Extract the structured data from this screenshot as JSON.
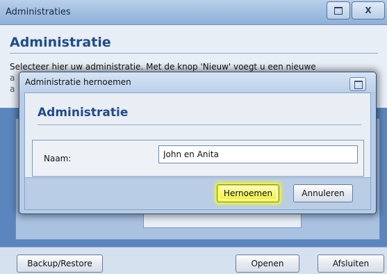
{
  "background_window": {
    "title": "Administraties",
    "heading": "Administratie",
    "description_line1": "Selecteer hier uw administratie. Met de knop 'Nieuw' voegt u een nieuwe",
    "description_line2": "a",
    "description_line3": "a",
    "buttons": {
      "backup_restore": "Backup/Restore",
      "open": "Openen",
      "close": "Afsluiten"
    },
    "window_controls": {
      "restore_icon": "restore-icon",
      "close_label": "X"
    }
  },
  "dialog": {
    "title": "Administratie hernoemen",
    "heading": "Administratie",
    "name_label": "Naam:",
    "name_value": "John en Anita",
    "buttons": {
      "rename": "Hernoemen",
      "cancel": "Annuleren"
    }
  },
  "colors": {
    "heading_blue": "#1f4b8c",
    "highlight_yellow": "#f5f52a"
  }
}
